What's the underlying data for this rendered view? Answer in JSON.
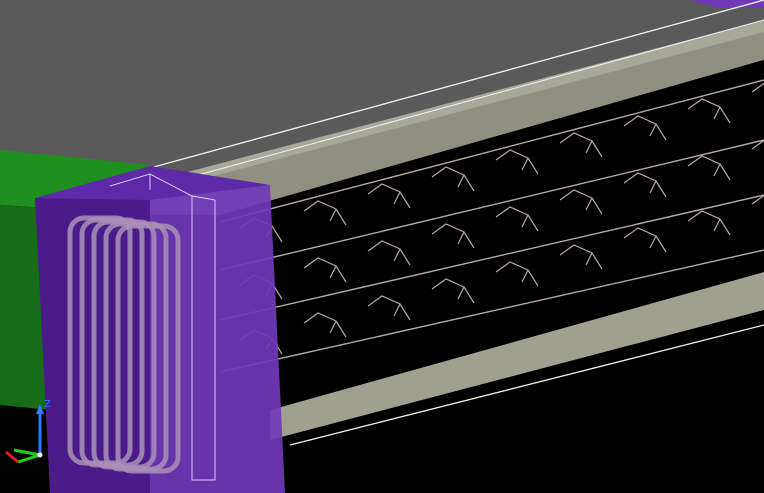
{
  "viewport": {
    "background": "#000000"
  },
  "axis_triad": {
    "z_label": "Z",
    "colors": {
      "x": "#e02020",
      "y": "#20d020",
      "z": "#2a7bff"
    }
  },
  "colors": {
    "ground_plane": "#5a5a5a",
    "slab_top_edge": "#a8a89a",
    "beam_green": "#1f8f1f",
    "beam_green_dark": "#176d17",
    "column_purple": "#4a1c8a",
    "column_purple_light": "#6f3ab8",
    "rebar": "#b8a8a8",
    "wire_outline": "#d8c8ff",
    "white_edge": "#f0f0f0"
  }
}
